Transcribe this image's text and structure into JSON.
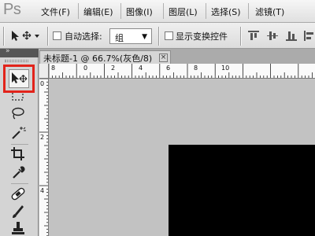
{
  "app": {
    "logo": "Ps"
  },
  "menu": [
    {
      "label": "文件(F)"
    },
    {
      "label": "编辑(E)"
    },
    {
      "label": "图像(I)"
    },
    {
      "label": "图层(L)"
    },
    {
      "label": "选择(S)"
    },
    {
      "label": "滤镜(T)"
    }
  ],
  "options": {
    "auto_select_label": "自动选择:",
    "auto_select_value": "组",
    "show_transform_label": "显示变换控件",
    "auto_select_checked": false,
    "show_transform_checked": false
  },
  "document": {
    "tab_title": "未标题-1 @ 66.7%(灰色/8)",
    "close_glyph": "×"
  },
  "rulers": {
    "horizontal": [
      "8",
      "0",
      "2",
      "4",
      "6",
      "8",
      "10"
    ],
    "vertical": [
      "0",
      "2",
      "4",
      "6"
    ]
  },
  "toolbar": {
    "tools": [
      "move-tool",
      "marquee-tool",
      "lasso-tool",
      "magic-wand-tool",
      "crop-tool",
      "eyedropper-tool",
      "healing-brush-tool",
      "brush-tool",
      "clone-stamp-tool"
    ],
    "active_tool": "move-tool",
    "highlight_color": "#e2231a"
  },
  "colors": {
    "workspace": "#c2c2c2",
    "canvas": "#000000",
    "highlight": "#e2231a"
  }
}
